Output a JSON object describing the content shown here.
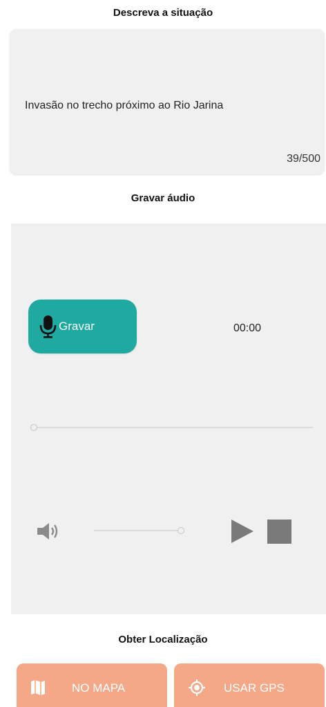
{
  "description": {
    "title": "Descreva a situação",
    "text": "Invasão no trecho próximo ao Rio Jarina",
    "counter": "39/500"
  },
  "audio": {
    "title": "Gravar áudio",
    "record_label": "Gravar",
    "timer": "00:00",
    "playback_progress": 0,
    "volume_level": 1.0
  },
  "location": {
    "title": "Obter Localização",
    "map_label": "NO MAPA",
    "gps_label": "USAR GPS"
  },
  "colors": {
    "record_button": "#1eaaa0",
    "location_buttons": "#f4a888",
    "panel_background": "#f0f0f0"
  },
  "icons": {
    "record": "mic-icon",
    "volume": "volume-icon",
    "play": "play-icon",
    "stop": "stop-icon",
    "map": "map-icon",
    "gps": "gps-icon"
  }
}
